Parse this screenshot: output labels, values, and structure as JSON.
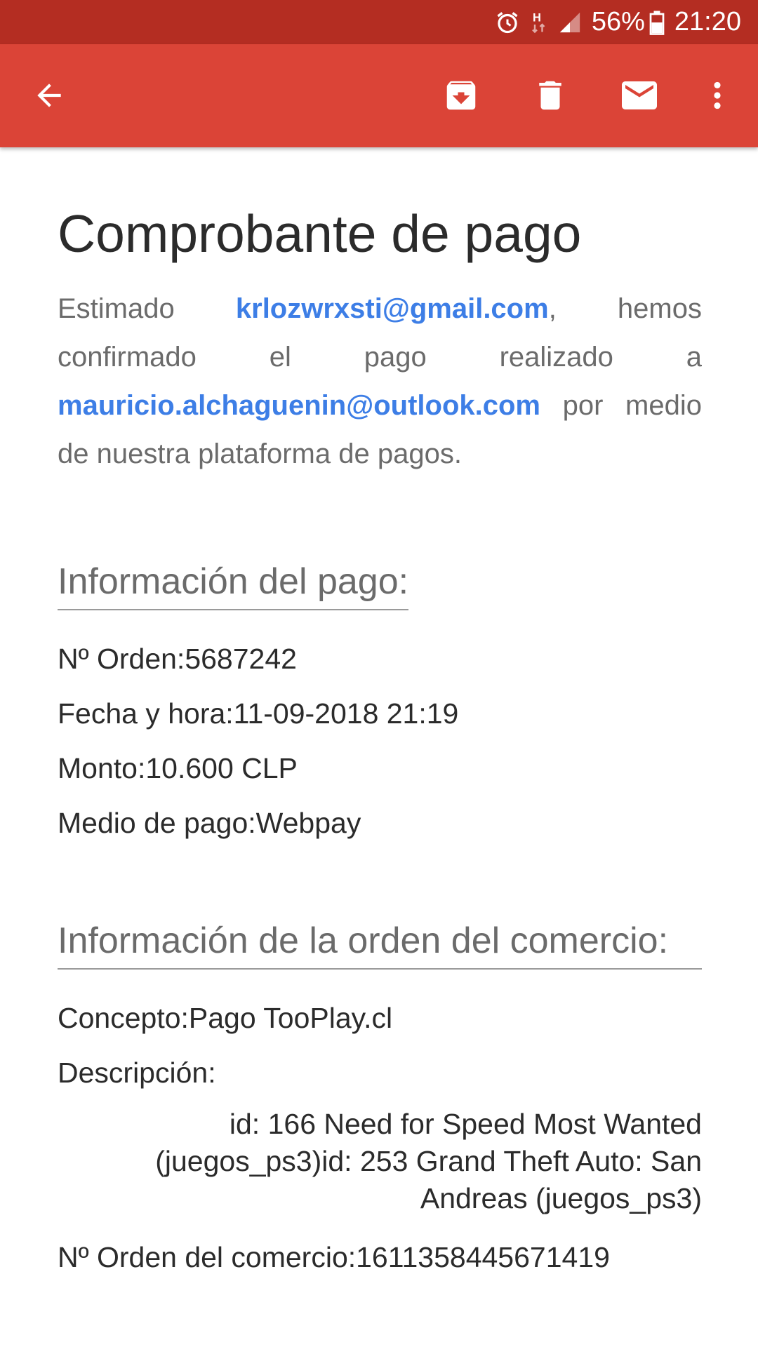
{
  "status_bar": {
    "icons": [
      "alarm-icon",
      "data-transfer-icon",
      "signal-icon",
      "battery-icon"
    ],
    "battery": "56%",
    "time": "21:20"
  },
  "app_bar": {
    "icons": [
      "back-arrow-icon",
      "archive-icon",
      "delete-icon",
      "mark-unread-icon",
      "more-vert-icon"
    ],
    "color": "#db4437",
    "status_color": "#b42d22"
  },
  "email": {
    "title": "Comprobante de pago",
    "intro": {
      "part1": "Estimado ",
      "email1": "krlozwrxsti@gmail.com",
      "part2": ", hemos confirmado el pago realizado a ",
      "email2": "mauricio.alchaguenin@outlook.com",
      "part3": " por medio de nuestra plataforma de pagos."
    },
    "link_color": "#3d7ee6",
    "payment_info": {
      "heading": "Información del pago:",
      "order": "Nº Orden:5687242",
      "datetime": "Fecha y hora:11-09-2018 21:19",
      "amount": "Monto:10.600 CLP",
      "method": "Medio de pago:Webpay"
    },
    "order_info": {
      "heading": "Información de la orden del comercio:",
      "concept": "Concepto:Pago TooPlay.cl",
      "description_label": "Descripción:",
      "description_line1": "id: 166 Need for Speed Most Wanted",
      "description_line2": "(juegos_ps3)id: 253 Grand Theft Auto: San",
      "description_line3": "Andreas (juegos_ps3)",
      "merchant_order": "Nº Orden del comercio:1611358445671419"
    }
  }
}
